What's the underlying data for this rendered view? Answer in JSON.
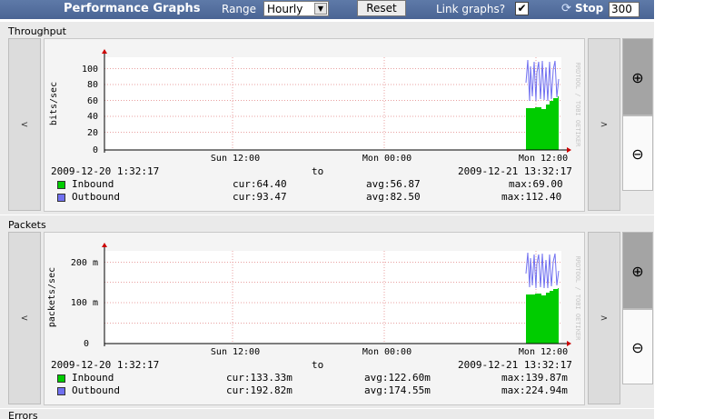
{
  "toolbar": {
    "title": "Performance Graphs",
    "range_label": "Range",
    "range_value": "Hourly",
    "reset_label": "Reset",
    "link_label": "Link graphs?",
    "link_checked": "✔",
    "stop_label": "Stop",
    "interval_value": "300"
  },
  "nav": {
    "prev": "<",
    "next": ">"
  },
  "watermark": "RRDTOOL / TOBI OETIKER",
  "graphs": [
    {
      "section_label": "Throughput",
      "ylabel": "bits/sec",
      "yticks": [
        "0",
        "20",
        "40",
        "60",
        "80",
        "100"
      ],
      "xticks": [
        "Sun 12:00",
        "Mon 00:00",
        "Mon 12:00"
      ],
      "start": "2009-12-20 1:32:17",
      "to": "to",
      "end": "2009-12-21 13:32:17",
      "legend": [
        {
          "name": "Inbound",
          "cur": "cur:64.40",
          "avg": "avg:56.87",
          "max": "max:69.00",
          "color": "#00cc00"
        },
        {
          "name": "Outbound",
          "cur": "cur:93.47",
          "avg": "avg:82.50",
          "max": "max:112.40",
          "color": "#7070f0"
        }
      ]
    },
    {
      "section_label": "Packets",
      "ylabel": "packets/sec",
      "yticks": [
        "0",
        "100 m",
        "200 m"
      ],
      "xticks": [
        "Sun 12:00",
        "Mon 00:00",
        "Mon 12:00"
      ],
      "start": "2009-12-20 1:32:17",
      "to": "to",
      "end": "2009-12-21 13:32:17",
      "legend": [
        {
          "name": "Inbound",
          "cur": "cur:133.33m",
          "avg": "avg:122.60m",
          "max": "max:139.87m",
          "color": "#00cc00"
        },
        {
          "name": "Outbound",
          "cur": "cur:192.82m",
          "avg": "avg:174.55m",
          "max": "max:224.94m",
          "color": "#7070f0"
        }
      ]
    },
    {
      "section_label": "Errors"
    }
  ]
}
